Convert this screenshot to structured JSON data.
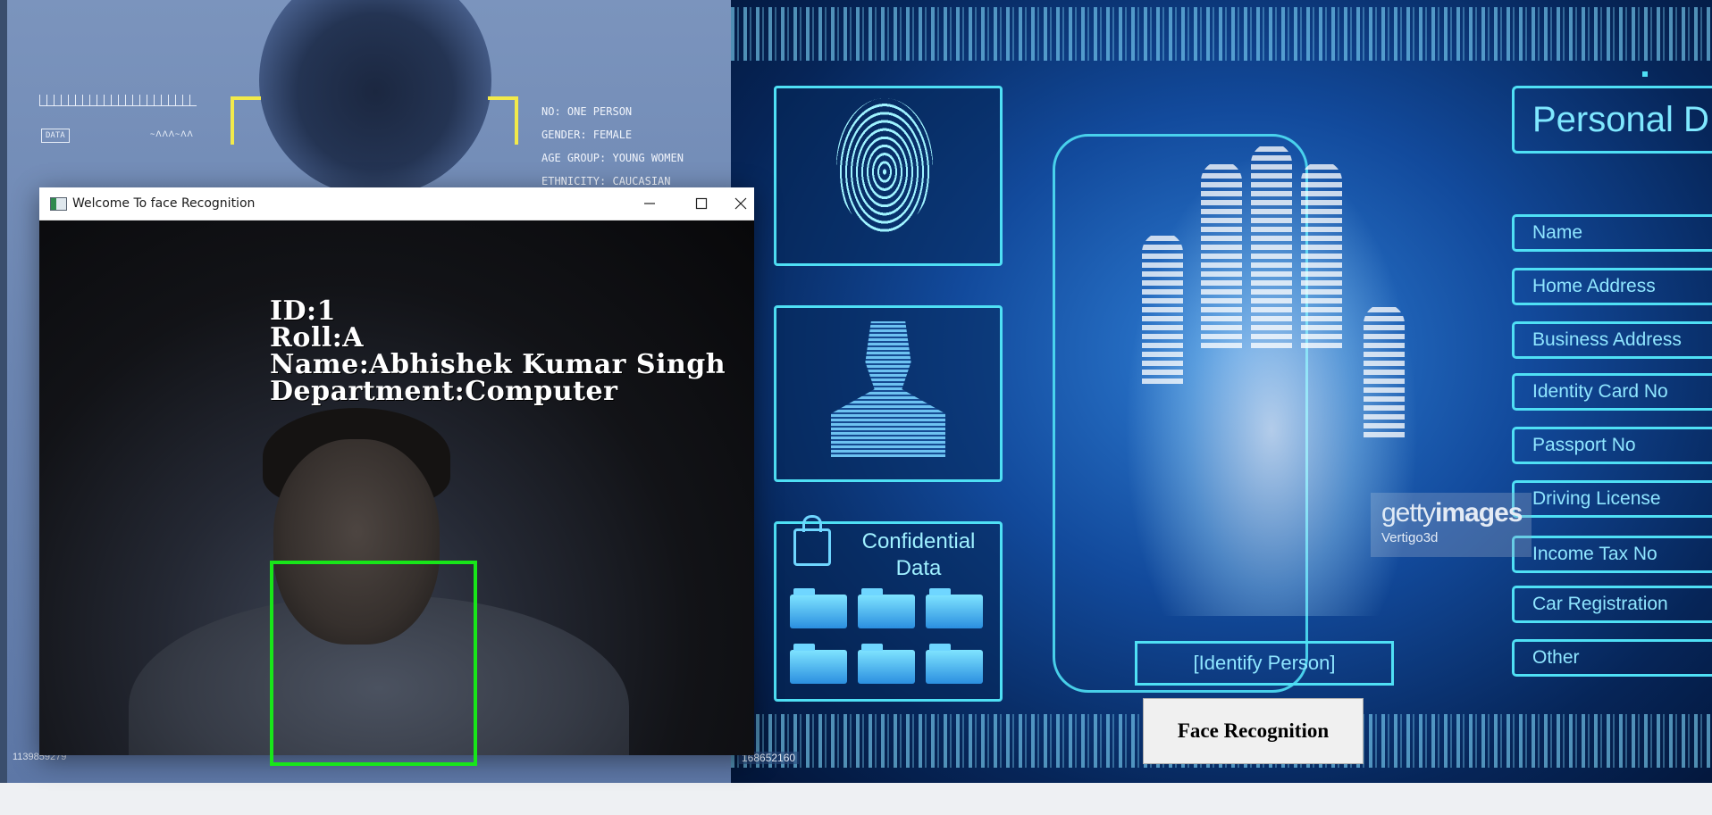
{
  "background_left": {
    "hud_lines": [
      "NO: ONE PERSON",
      "GENDER: FEMALE",
      "AGE GROUP: YOUNG WOMEN",
      "ETHNICITY: CAUCASIAN"
    ],
    "data_label": "DATA",
    "image_id": "1139859279"
  },
  "background_right": {
    "heading": "Personal D",
    "fields": [
      "Name",
      "Home Address",
      "Business Address",
      "Identity Card No",
      "Passport No",
      "Driving License",
      "Income Tax No",
      "Car Registration",
      "Other"
    ],
    "confidential_label": "Confidential Data",
    "identify_label": "[Identify Person]",
    "watermark": {
      "brand_light": "getty",
      "brand_bold": "images",
      "author": "Vertigo3d"
    },
    "image_id": "168652160"
  },
  "main_button": {
    "label": "Face Recognition"
  },
  "window": {
    "title": "Welcome To face Recognition",
    "controls": {
      "minimize_icon": "minimize-icon",
      "maximize_icon": "maximize-icon",
      "close_icon": "close-icon"
    },
    "overlay": {
      "id_line": "ID:1",
      "roll_line": "Roll:A",
      "name_line": "Name:Abhishek Kumar Singh",
      "department_line": "Department:Computer"
    },
    "box_color": "#18e619"
  },
  "colors": {
    "accent_cyan": "#4fe0f5",
    "hud_yellow": "#f2ea4a",
    "window_bg": "#ffffff"
  }
}
